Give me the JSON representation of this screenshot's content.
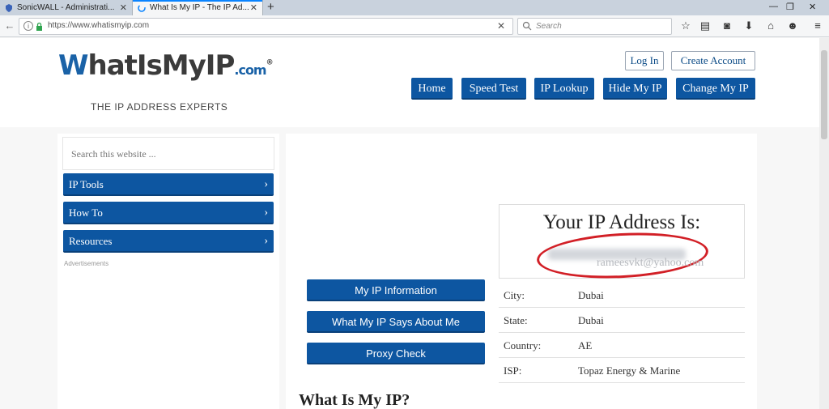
{
  "browser": {
    "tabs": [
      {
        "label": "SonicWALL - Administrati..."
      },
      {
        "label": "What Is My IP - The IP Ad..."
      }
    ],
    "url": "https://www.whatismyip.com",
    "search_placeholder": "Search"
  },
  "header": {
    "logo": {
      "part1": "W",
      "part2": "hatIsMyIP",
      "suffix": ".com",
      "reg": "®",
      "tagline": "THE IP ADDRESS EXPERTS"
    },
    "account": {
      "login": "Log In",
      "create": "Create Account"
    },
    "menu": [
      "Home",
      "Speed Test",
      "IP Lookup",
      "Hide My IP",
      "Change My IP"
    ]
  },
  "sidebar": {
    "search_placeholder": "Search this website ...",
    "items": [
      "IP Tools",
      "How To",
      "Resources"
    ],
    "ads_label": "Advertisements"
  },
  "main": {
    "ip_title": "Your IP Address Is:",
    "watermark": "rameesvkt@yahoo.com",
    "buttons": [
      "My IP Information",
      "What My IP Says About Me",
      "Proxy Check"
    ],
    "info": [
      {
        "key": "City:",
        "value": "Dubai"
      },
      {
        "key": "State:",
        "value": "Dubai"
      },
      {
        "key": "Country:",
        "value": "AE"
      },
      {
        "key": "ISP:",
        "value": "Topaz Energy & Marine"
      }
    ],
    "heading": "What Is My IP?"
  },
  "colors": {
    "brand_blue": "#0d56a1",
    "highlight_red": "#d21f26"
  }
}
